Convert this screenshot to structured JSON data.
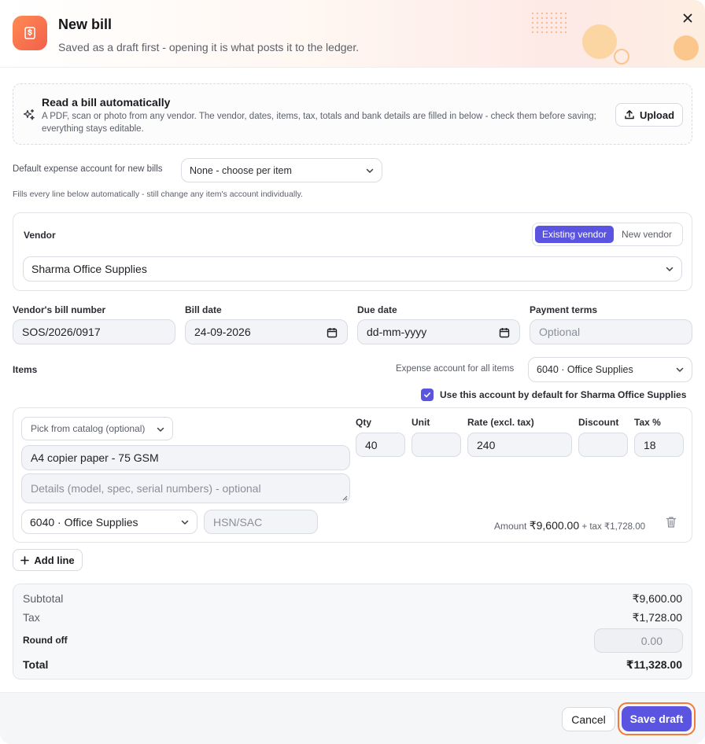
{
  "header": {
    "title": "New bill",
    "subtitle": "Saved as a draft first - opening it is what posts it to the ledger."
  },
  "upload": {
    "title": "Read a bill automatically",
    "description": "A PDF, scan or photo from any vendor. The vendor, dates, items, tax, totals and bank details are filled in below - check them before saving; everything stays editable.",
    "button_label": "Upload"
  },
  "default_expense": {
    "label": "Default expense account for new bills",
    "value": "None - choose per item",
    "hint": "Fills every line below automatically - still change any item's account individually."
  },
  "vendor": {
    "label": "Vendor",
    "toggle_existing": "Existing vendor",
    "toggle_new": "New vendor",
    "selected": "Sharma Office Supplies"
  },
  "fields": {
    "bill_number_label": "Vendor's bill number",
    "bill_number_value": "SOS/2026/0917",
    "bill_date_label": "Bill date",
    "bill_date_value": "24-09-2026",
    "due_date_label": "Due date",
    "due_date_value": "dd-mm-yyyy",
    "payment_terms_label": "Payment terms",
    "payment_terms_placeholder": "Optional"
  },
  "items": {
    "label": "Items",
    "expense_all_label": "Expense account for all items",
    "expense_all_value": "6040 · Office Supplies",
    "default_checkbox_label": "Use this account by default for Sharma Office Supplies",
    "default_checked": true,
    "lines": [
      {
        "catalog_placeholder": "Pick from catalog (optional)",
        "name": "A4 copier paper - 75 GSM",
        "details_placeholder": "Details (model, spec, serial numbers) - optional",
        "account": "6040 · Office Supplies",
        "hsn_placeholder": "HSN/SAC",
        "qty_label": "Qty",
        "qty": "40",
        "unit_label": "Unit",
        "unit": "",
        "rate_label": "Rate (excl. tax)",
        "rate": "240",
        "discount_label": "Discount",
        "discount": "",
        "tax_label": "Tax %",
        "tax": "18",
        "amount_label": "Amount",
        "amount": "₹9,600.00",
        "tax_amount": "+ tax ₹1,728.00"
      }
    ],
    "add_line_label": "Add line"
  },
  "totals": {
    "subtotal_label": "Subtotal",
    "subtotal": "₹9,600.00",
    "tax_label": "Tax",
    "tax": "₹1,728.00",
    "round_off_label": "Round off",
    "round_off_placeholder": "0.00",
    "total_label": "Total",
    "total": "₹11,328.00"
  },
  "footer": {
    "cancel_label": "Cancel",
    "save_label": "Save draft"
  },
  "colors": {
    "accent": "#5a54e0",
    "header_icon": "#f2604a",
    "focus_ring": "#f27a3a"
  }
}
